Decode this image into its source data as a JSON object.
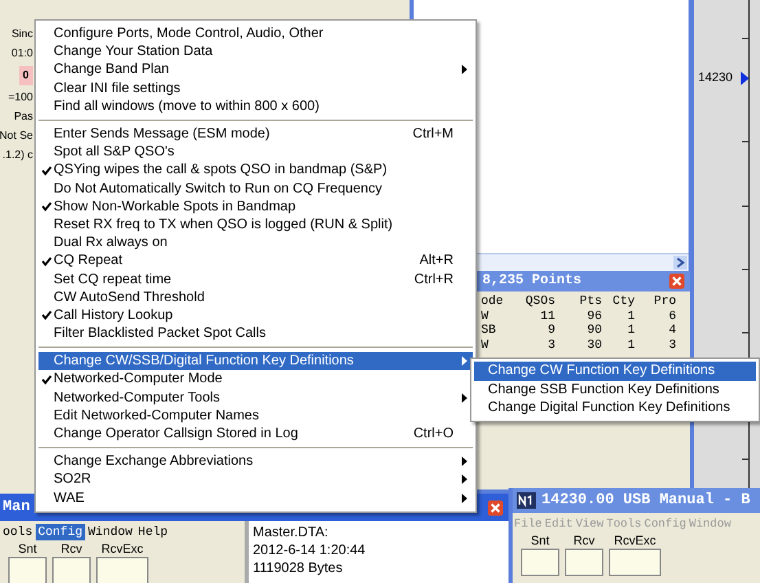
{
  "left_window": {
    "fragments": [
      {
        "kind": "text",
        "text": "Sinc"
      },
      {
        "kind": "text",
        "text": "01:0"
      },
      {
        "kind": "box",
        "text": "0"
      },
      {
        "kind": "text",
        "text": "=100"
      },
      {
        "kind": "text",
        "text": "Pas"
      },
      {
        "kind": "text",
        "text": "Not Se"
      },
      {
        "kind": "text",
        "text": ".1.2) c"
      }
    ]
  },
  "score_window": {
    "title": "8,235 Points",
    "columns": [
      "ode",
      "QSOs",
      "Pts",
      "Cty",
      "Pro"
    ],
    "rows": [
      [
        "W",
        "11",
        "96",
        "1",
        "6"
      ],
      [
        "SB",
        "9",
        "90",
        "1",
        "4"
      ],
      [
        "W",
        "3",
        "30",
        "1",
        "3"
      ]
    ]
  },
  "bandmap": {
    "frequency": "14230"
  },
  "entry_window_left": {
    "title": "Man",
    "menu": [
      {
        "label": "ools",
        "selected": false
      },
      {
        "label": "Config",
        "selected": true
      },
      {
        "label": "Window",
        "selected": false
      },
      {
        "label": "Help",
        "selected": false
      }
    ],
    "fields": [
      "Snt",
      "Rcv",
      "RcvExc"
    ],
    "info": [
      "Master.DTA:",
      "2012-6-14 1:20:44",
      "1119028 Bytes"
    ]
  },
  "entry_window_right": {
    "title": "14230.00 USB Manual - B",
    "menu": [
      {
        "label": "File",
        "disabled": true
      },
      {
        "label": "Edit",
        "disabled": true
      },
      {
        "label": "View",
        "disabled": true
      },
      {
        "label": "Tools",
        "disabled": true
      },
      {
        "label": "Config",
        "disabled": true
      },
      {
        "label": "Window",
        "disabled": true
      }
    ],
    "fields": [
      "Snt",
      "Rcv",
      "RcvExc"
    ]
  },
  "config_menu": {
    "items": [
      {
        "kind": "item",
        "label": "Configure Ports, Mode Control, Audio, Other",
        "checked": false,
        "submenu": false,
        "selected": false
      },
      {
        "kind": "item",
        "label": "Change Your Station Data",
        "checked": false,
        "submenu": false,
        "selected": false
      },
      {
        "kind": "item",
        "label": "Change Band Plan",
        "checked": false,
        "submenu": true,
        "selected": false
      },
      {
        "kind": "item",
        "label": "Clear INI file settings",
        "checked": false,
        "submenu": false,
        "selected": false
      },
      {
        "kind": "item",
        "label": "Find all windows (move to within 800 x 600)",
        "checked": false,
        "submenu": false,
        "selected": false
      },
      {
        "kind": "separator"
      },
      {
        "kind": "item",
        "label": "Enter Sends Message (ESM mode)",
        "checked": false,
        "shortcut": "Ctrl+M",
        "submenu": false,
        "selected": false
      },
      {
        "kind": "item",
        "label": "Spot all S&P QSO's",
        "checked": false,
        "submenu": false,
        "selected": false
      },
      {
        "kind": "item",
        "label": "QSYing wipes the call & spots QSO in bandmap (S&P)",
        "checked": true,
        "submenu": false,
        "selected": false
      },
      {
        "kind": "item",
        "label": "Do Not Automatically Switch to Run on CQ Frequency",
        "checked": false,
        "submenu": false,
        "selected": false
      },
      {
        "kind": "item",
        "label": "Show Non-Workable Spots in Bandmap",
        "checked": true,
        "submenu": false,
        "selected": false
      },
      {
        "kind": "item",
        "label": "Reset RX freq to TX when QSO is logged (RUN & Split)",
        "checked": false,
        "submenu": false,
        "selected": false
      },
      {
        "kind": "item",
        "label": "Dual Rx always on",
        "checked": false,
        "submenu": false,
        "selected": false
      },
      {
        "kind": "item",
        "label": "CQ Repeat",
        "checked": true,
        "shortcut": "Alt+R",
        "submenu": false,
        "selected": false
      },
      {
        "kind": "item",
        "label": "Set CQ repeat time",
        "checked": false,
        "shortcut": "Ctrl+R",
        "submenu": false,
        "selected": false
      },
      {
        "kind": "item",
        "label": "CW AutoSend Threshold",
        "checked": false,
        "submenu": false,
        "selected": false
      },
      {
        "kind": "item",
        "label": "Call History Lookup",
        "checked": true,
        "submenu": false,
        "selected": false
      },
      {
        "kind": "item",
        "label": "Filter Blacklisted Packet Spot Calls",
        "checked": false,
        "submenu": false,
        "selected": false
      },
      {
        "kind": "separator"
      },
      {
        "kind": "item",
        "label": "Change CW/SSB/Digital Function Key Definitions",
        "checked": false,
        "submenu": true,
        "selected": true
      },
      {
        "kind": "item",
        "label": "Networked-Computer Mode",
        "checked": true,
        "submenu": false,
        "selected": false
      },
      {
        "kind": "item",
        "label": "Networked-Computer Tools",
        "checked": false,
        "submenu": true,
        "selected": false
      },
      {
        "kind": "item",
        "label": "Edit Networked-Computer Names",
        "checked": false,
        "submenu": false,
        "selected": false
      },
      {
        "kind": "item",
        "label": "Change Operator Callsign Stored in Log",
        "checked": false,
        "shortcut": "Ctrl+O",
        "submenu": false,
        "selected": false
      },
      {
        "kind": "separator"
      },
      {
        "kind": "item",
        "label": "Change Exchange Abbreviations",
        "checked": false,
        "submenu": true,
        "selected": false
      },
      {
        "kind": "item",
        "label": "SO2R",
        "checked": false,
        "submenu": true,
        "selected": false
      },
      {
        "kind": "item",
        "label": "WAE",
        "checked": false,
        "submenu": true,
        "selected": false
      }
    ]
  },
  "submenu": {
    "items": [
      {
        "label": "Change CW Function Key Definitions",
        "selected": true
      },
      {
        "label": "Change SSB Function Key Definitions",
        "selected": false
      },
      {
        "label": "Change Digital Function Key Definitions",
        "selected": false
      }
    ]
  }
}
